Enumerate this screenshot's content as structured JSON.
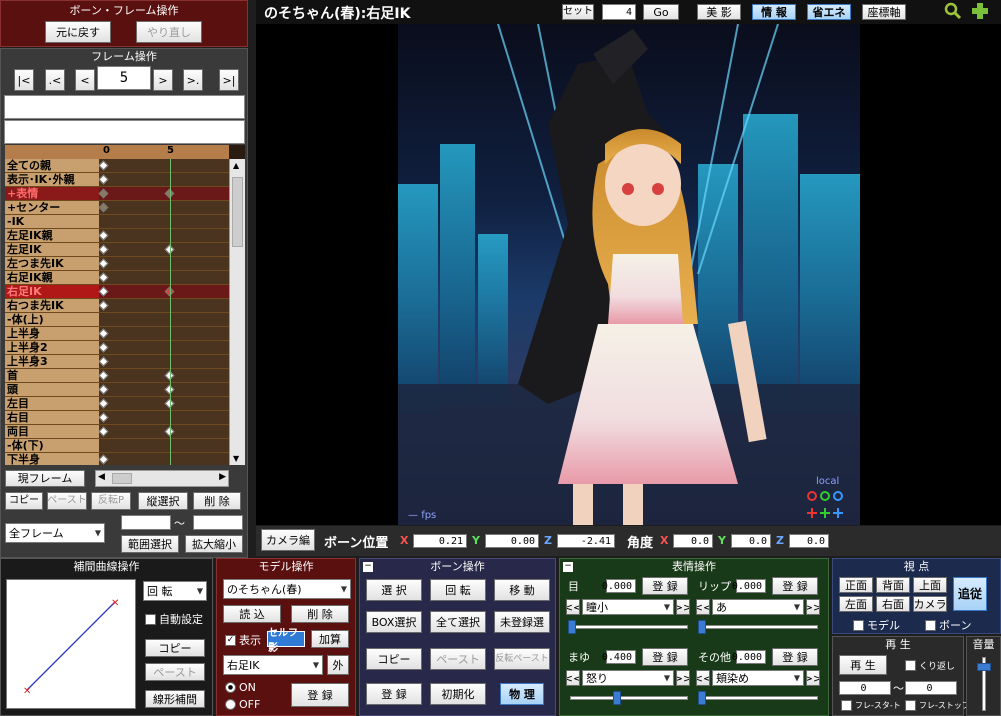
{
  "bone_frame_op": {
    "title": "ボーン・フレーム操作",
    "undo": "元に戻す",
    "redo": "やり直し"
  },
  "frame_op": {
    "title": "フレーム操作",
    "nav": [
      "|<",
      ".<",
      "<",
      ">",
      ">.",
      ">|"
    ],
    "current_frame": "5",
    "current_frame_btn": "現フレーム",
    "copy": "コピー",
    "paste": "ペースト",
    "reverse_paste": "反転P",
    "vertical_select": "縦選択",
    "delete": "削 除",
    "range_select": "範囲選択",
    "scale": "拡大縮小",
    "all_frames": "全フレーム",
    "tilde": "〜"
  },
  "timeline": {
    "ruler": [
      "0",
      "5"
    ],
    "rows": [
      {
        "name": "全ての親",
        "keys": [
          0
        ]
      },
      {
        "name": "表示･IK･外親",
        "keys": [
          0
        ]
      },
      {
        "name": "+表情",
        "keys": [
          0,
          5
        ],
        "grey": true,
        "highlight": "section"
      },
      {
        "name": "+センター",
        "keys": [
          0
        ],
        "grey": true
      },
      {
        "name": "-IK",
        "keys": []
      },
      {
        "name": "左足IK親",
        "keys": [
          0
        ]
      },
      {
        "name": "左足IK",
        "keys": [
          0,
          5
        ]
      },
      {
        "name": "左つま先IK",
        "keys": [
          0
        ]
      },
      {
        "name": "右足IK親",
        "keys": [
          0
        ]
      },
      {
        "name": "右足IK",
        "keys": [
          0,
          5
        ],
        "highlight": "selected"
      },
      {
        "name": "右つま先IK",
        "keys": [
          0
        ]
      },
      {
        "name": "-体(上)",
        "keys": []
      },
      {
        "name": "上半身",
        "keys": [
          0
        ]
      },
      {
        "name": "上半身2",
        "keys": [
          0
        ]
      },
      {
        "name": "上半身3",
        "keys": [
          0
        ]
      },
      {
        "name": "首",
        "keys": [
          0,
          5
        ]
      },
      {
        "name": "頭",
        "keys": [
          0,
          5
        ]
      },
      {
        "name": "左目",
        "keys": [
          0,
          5
        ]
      },
      {
        "name": "右目",
        "keys": [
          0
        ]
      },
      {
        "name": "両目",
        "keys": [
          0,
          5
        ]
      },
      {
        "name": "-体(下)",
        "keys": []
      },
      {
        "name": "下半身",
        "keys": [
          0
        ]
      }
    ]
  },
  "viewport": {
    "title": "のそちゃん(春):右足IK",
    "set_label": "セット",
    "set_value": "4",
    "go": "Go",
    "beauty": "美 影",
    "info": "情 報",
    "eco": "省エネ",
    "axis": "座標軸",
    "local": "local",
    "fps": "fps"
  },
  "bone_pos": {
    "camera_btn": "カメラ編",
    "pos_label": "ボーン位置",
    "x": "0.21",
    "y": "0.00",
    "z": "-2.41",
    "angle_label": "角度",
    "ax": "0.0",
    "ay": "0.0",
    "az": "0.0"
  },
  "curve": {
    "title": "補間曲線操作",
    "mode": "回 転",
    "auto": "自動設定",
    "copy": "コピー",
    "paste": "ペースト",
    "linear": "線形補間"
  },
  "model": {
    "title": "モデル操作",
    "model_name": "のそちゃん(春)",
    "load": "読 込",
    "delete": "削 除",
    "display": "表示",
    "self_shadow": "セルフ影",
    "add": "加算",
    "bone_select": "右足IK",
    "outer": "外",
    "on": "ON",
    "off": "OFF",
    "register": "登 録"
  },
  "bone_op": {
    "title": "ボーン操作",
    "select": "選 択",
    "rotate": "回 転",
    "move": "移 動",
    "box_select": "BOX選択",
    "select_all": "全て選択",
    "unregistered": "未登録選",
    "copy": "コピー",
    "paste": "ペースト",
    "reverse_paste": "反転ペースト",
    "register": "登 録",
    "init": "初期化",
    "physics": "物 理"
  },
  "expression": {
    "title": "表情操作",
    "eye_label": "目",
    "eye_value": "0.000",
    "eye_select": "瞳小",
    "lip_label": "リップ",
    "lip_value": "0.000",
    "lip_select": "あ",
    "brow_label": "まゆ",
    "brow_value": "0.400",
    "brow_select": "怒り",
    "other_label": "その他",
    "other_value": "0.000",
    "other_select": "頬染め",
    "register": "登 録"
  },
  "view": {
    "title": "視 点",
    "front": "正面",
    "back": "背面",
    "top": "上面",
    "follow": "追従",
    "left": "左面",
    "right": "右面",
    "camera": "カメラ",
    "model": "モデル",
    "bone": "ボーン"
  },
  "playback": {
    "title": "再 生",
    "play": "再 生",
    "repeat": "くり返し",
    "start": "0",
    "end": "0",
    "tilde": "〜",
    "frame_start": "フレ-スタ-ト",
    "frame_stop": "フレ-ストップ"
  },
  "volume": {
    "title": "音量"
  }
}
